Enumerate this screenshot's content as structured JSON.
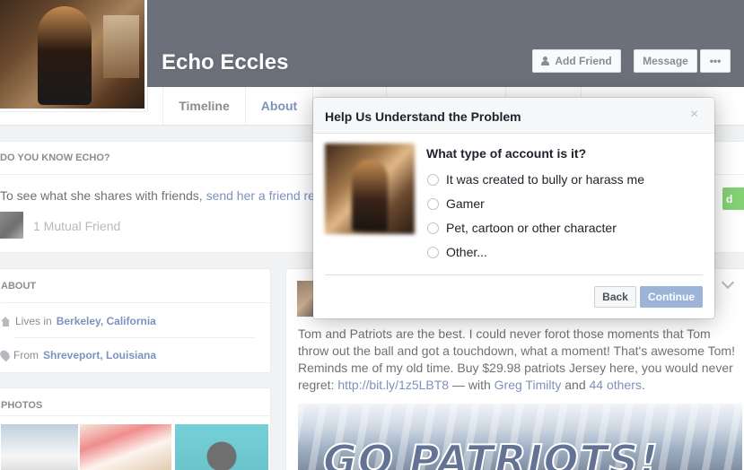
{
  "profile": {
    "name": "Echo Eccles",
    "add_friend_label": "Add Friend",
    "message_label": "Message",
    "more_label": "•••"
  },
  "tabs": {
    "timeline": "Timeline",
    "about": "About"
  },
  "know_card": {
    "title": "DO YOU KNOW ECHO?",
    "text_prefix": "To see what she shares with friends,",
    "link": "send her a friend re",
    "mutual": "1 Mutual Friend",
    "green_button": "d"
  },
  "about_card": {
    "title": "ABOUT",
    "lives_prefix": "Lives in",
    "lives_value": "Berkeley, California",
    "from_prefix": "From",
    "from_value": "Shreveport, Louisiana"
  },
  "photos_card": {
    "title": "PHOTOS"
  },
  "post": {
    "text": "Tom and Patriots are the best. I could never forot those moments that Tom throw out the ball and got a touchdown, what a moment! That's awesome Tom! Reminds me of my old time. Buy $29.98 patriots Jersey here, you would never regret:",
    "link": "http://bit.ly/1z5LBT8",
    "with_text": "— with",
    "tagged_name": "Greg Timilty",
    "and_text": "and",
    "others_link": "44 others",
    "period": ".",
    "image_text": "GO PATRIOTS!"
  },
  "dialog": {
    "title": "Help Us Understand the Problem",
    "close": "×",
    "question": "What type of account is it?",
    "options": [
      "It was created to bully or harass me",
      "Gamer",
      "Pet, cartoon or other character",
      "Other..."
    ],
    "back_label": "Back",
    "continue_label": "Continue"
  }
}
